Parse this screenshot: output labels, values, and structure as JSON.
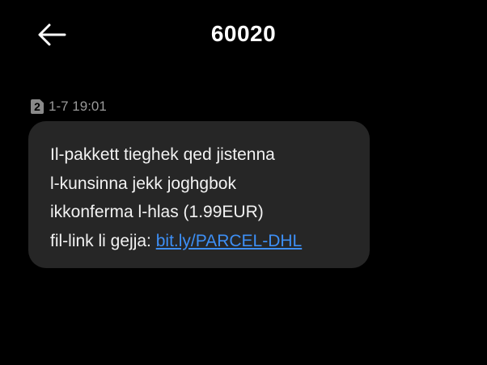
{
  "header": {
    "title": "60020",
    "back_icon": "arrow-left-icon"
  },
  "message": {
    "sim_slot": "2",
    "timestamp": "1-7 19:01",
    "lines": [
      "Il-pakkett tieghek qed jistenna",
      "l-kunsinna jekk joghgbok",
      "ikkonferma l-hlas (1.99EUR)"
    ],
    "last_line_prefix": "fil-link li gejja: ",
    "link_text": "bit.ly/PARCEL-DHL",
    "link_color": "#3d8ff5"
  }
}
